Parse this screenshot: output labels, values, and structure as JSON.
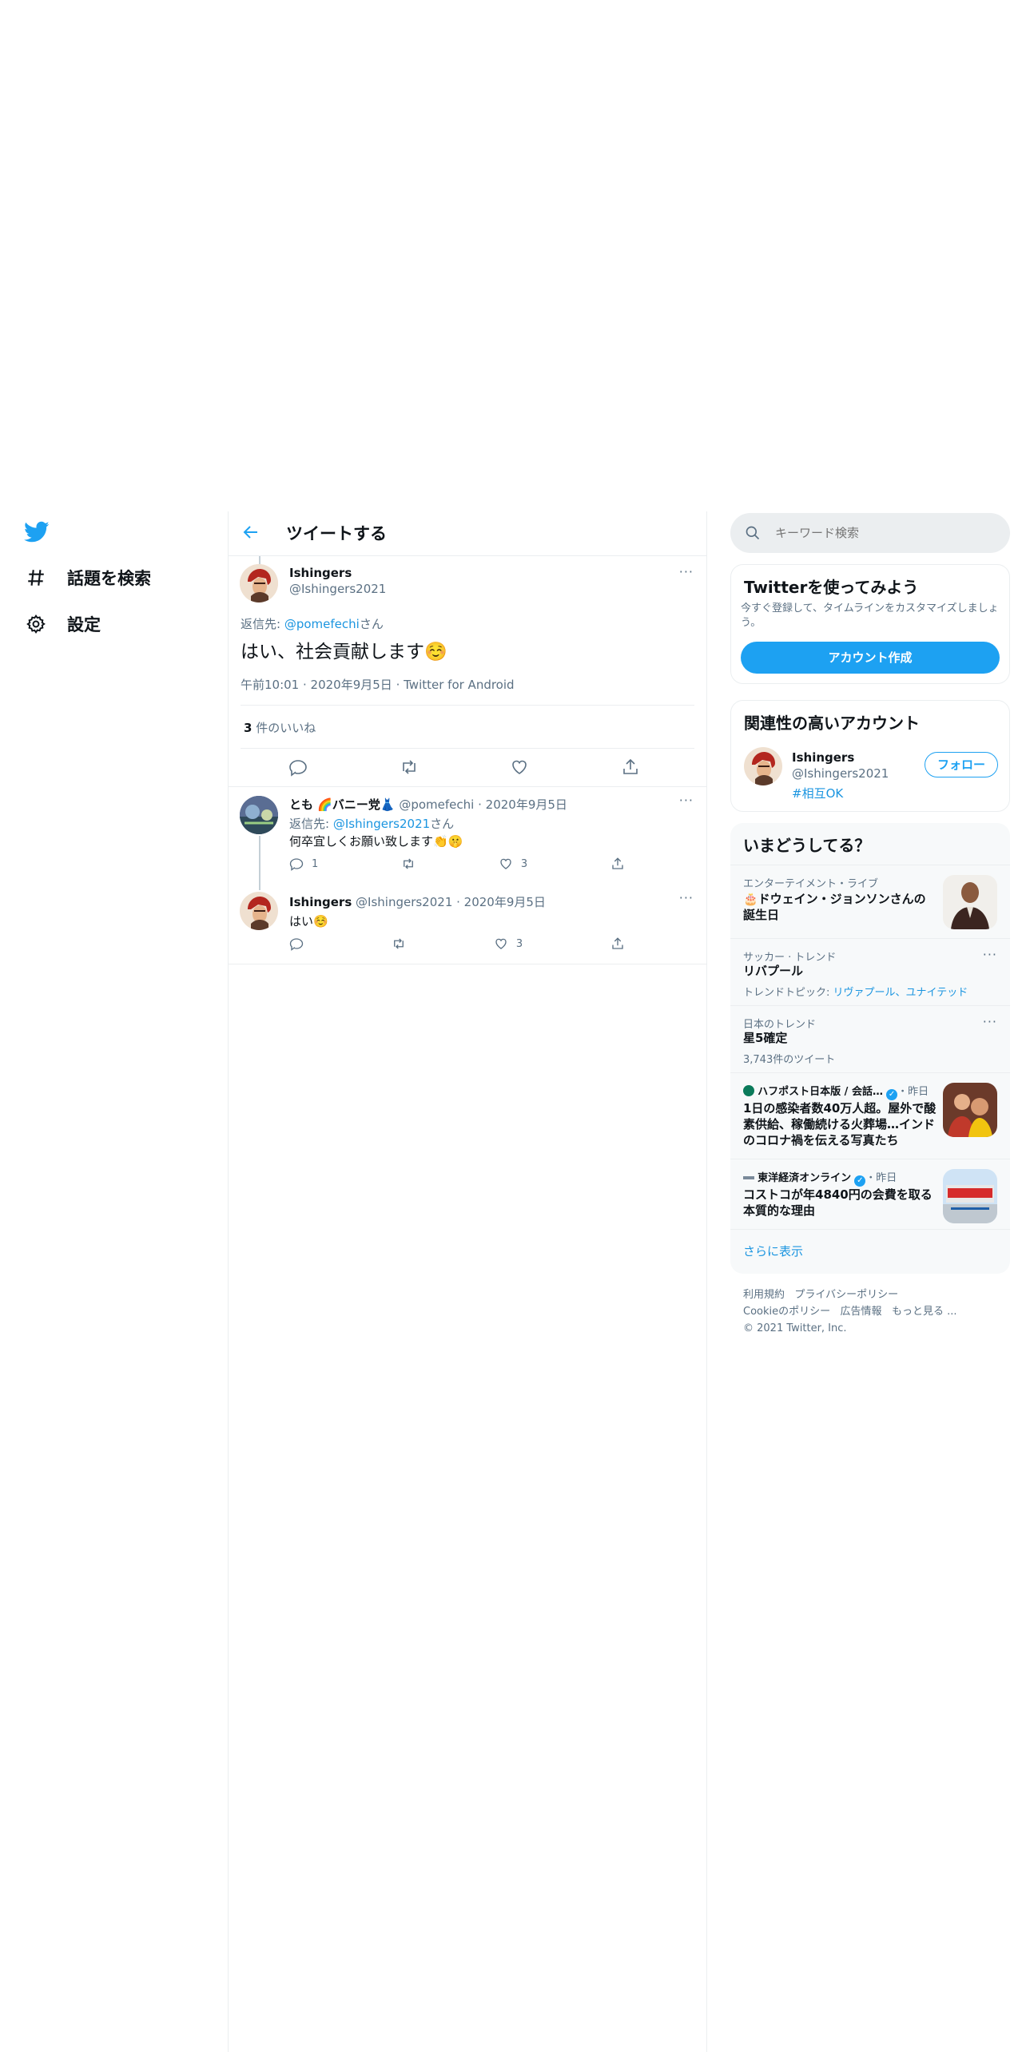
{
  "colors": {
    "accent": "#1da1f2",
    "link": "#1b95e0",
    "muted": "#5b7083",
    "border": "#ebeef0"
  },
  "nav": {
    "logo_icon": "twitter-bird-icon",
    "items": [
      {
        "label": "話題を検索",
        "icon": "hashtag-icon"
      },
      {
        "label": "設定",
        "icon": "gear-icon"
      }
    ]
  },
  "header": {
    "title": "ツイートする",
    "back_icon": "back-arrow-icon"
  },
  "main_tweet": {
    "name": "Ishingers",
    "handle": "@Ishingers2021",
    "reply_to_prefix": "返信先: ",
    "reply_to_handle": "@pomefechi",
    "reply_to_suffix": "さん",
    "text": "はい、社会貢献します☺️",
    "meta_time": "午前10:01",
    "meta_date": "2020年9月5日",
    "meta_client": "Twitter for Android",
    "likes_count": "3",
    "likes_label": " 件のいいね"
  },
  "replies": [
    {
      "name": "とも 🌈バニー党👗",
      "handle": "@pomefechi",
      "date": "2020年9月5日",
      "reply_to_prefix": "返信先: ",
      "reply_to_handle": "@Ishingers2021",
      "reply_to_suffix": "さん",
      "text": "何卒宜しくお願い致します👏🤫",
      "reply_count": "1",
      "like_count": "3"
    },
    {
      "name": "Ishingers",
      "handle": "@Ishingers2021",
      "date": "2020年9月5日",
      "text": "はい☺️",
      "like_count": "3"
    }
  ],
  "sidebar": {
    "search_placeholder": "キーワード検索",
    "signup": {
      "title": "Twitterを使ってみよう",
      "desc": "今すぐ登録して、タイムラインをカスタマイズしましょう。",
      "button": "アカウント作成"
    },
    "related": {
      "title": "関連性の高いアカウント",
      "name": "Ishingers",
      "handle": "@Ishingers2021",
      "bio": "#相互OK",
      "follow": "フォロー"
    },
    "trends": {
      "title": "いまどうしてる？",
      "items": [
        {
          "cat": "エンターテイメント・ライブ",
          "title": "🎂ドウェイン・ジョンソンさんの誕生日"
        },
        {
          "cat": "サッカー · トレンド",
          "title": "リバプール",
          "sub_prefix": "トレンドトピック: ",
          "sub_links": "リヴァプール、ユナイテッド"
        },
        {
          "cat": "日本のトレンド",
          "title": "星5確定",
          "sub": "3,743件のツイート"
        },
        {
          "source": "ハフポスト日本版 / 会話…",
          "time": "・昨日",
          "title": "1日の感染者数40万人超。屋外で酸素供給、稼働続ける火葬場…インドのコロナ禍を伝える写真たち"
        },
        {
          "source": "東洋経済オンライン",
          "time": "・昨日",
          "title": "コストコが年4840円の会費を取る本質的な理由"
        }
      ],
      "show_more": "さらに表示"
    },
    "footer": {
      "links1": [
        "利用規約",
        "プライバシーポリシー"
      ],
      "links2": [
        "Cookieのポリシー",
        "広告情報",
        "もっと見る ..."
      ],
      "copyright": "© 2021 Twitter, Inc."
    }
  }
}
